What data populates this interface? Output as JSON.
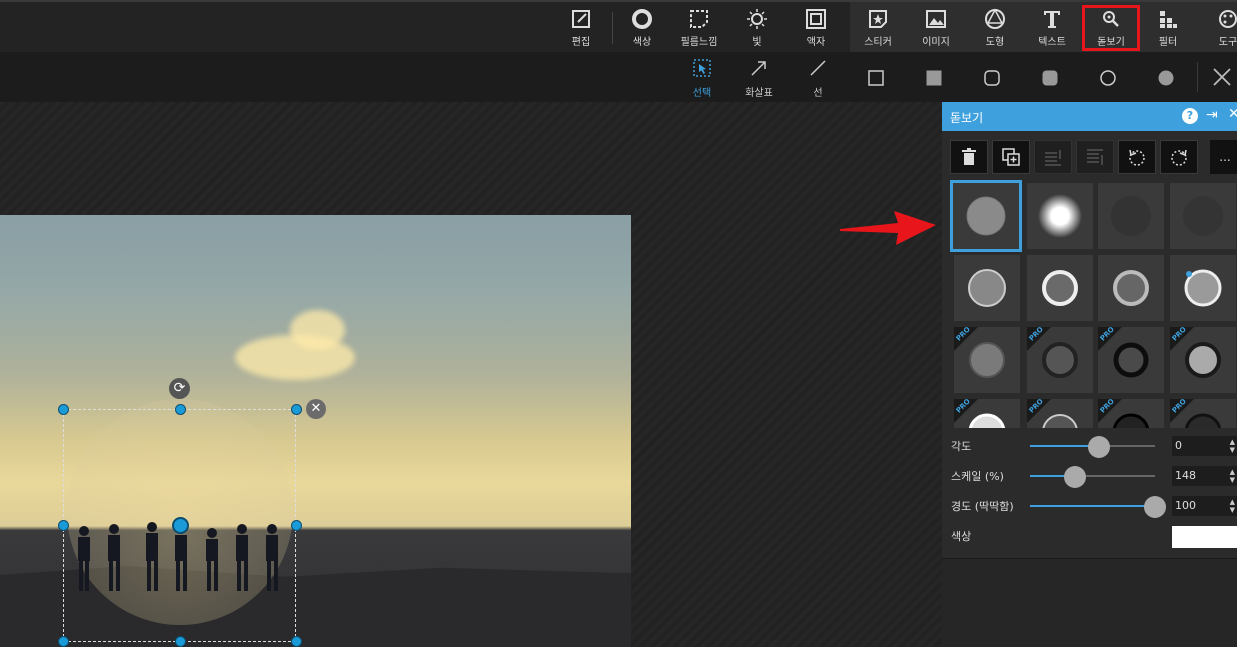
{
  "toolbar": {
    "tools": [
      {
        "label": "편집",
        "icon": "edit-icon"
      },
      {
        "label": "색상",
        "icon": "color-icon"
      },
      {
        "label": "필름느낌",
        "icon": "film-icon"
      },
      {
        "label": "빛",
        "icon": "light-icon"
      },
      {
        "label": "액자",
        "icon": "frame-icon"
      },
      {
        "label": "스티커",
        "icon": "sticker-icon"
      },
      {
        "label": "이미지",
        "icon": "image-icon"
      },
      {
        "label": "도형",
        "icon": "shape-icon"
      },
      {
        "label": "텍스트",
        "icon": "text-icon"
      },
      {
        "label": "돋보기",
        "icon": "magnifier-icon"
      },
      {
        "label": "필터",
        "icon": "filter-icon"
      },
      {
        "label": "도구",
        "icon": "tools-icon"
      }
    ],
    "highlighted": "돋보기",
    "highlight_color": "#e8161b"
  },
  "subtoolbar": {
    "tools": [
      {
        "label": "선택",
        "icon": "select-icon"
      },
      {
        "label": "화살표",
        "icon": "arrow-icon"
      },
      {
        "label": "선",
        "icon": "line-icon"
      }
    ],
    "shapes": [
      "rectangle-outline",
      "rectangle-filled",
      "rounded-rect-outline",
      "rounded-rect-filled",
      "circle-outline",
      "circle-filled"
    ],
    "accent": "#3ea0dc"
  },
  "panel": {
    "title": "돋보기",
    "help": "?",
    "more": "...",
    "pro_badge": "PRO",
    "properties": [
      {
        "label": "각도",
        "value": "0",
        "fraction": 0.55
      },
      {
        "label": "스케일 (%)",
        "value": "148",
        "fraction": 0.36
      },
      {
        "label": "경도 (딱딱함)",
        "value": "100",
        "fraction": 1.0
      },
      {
        "label": "색상",
        "value": "#ffffff"
      }
    ]
  }
}
